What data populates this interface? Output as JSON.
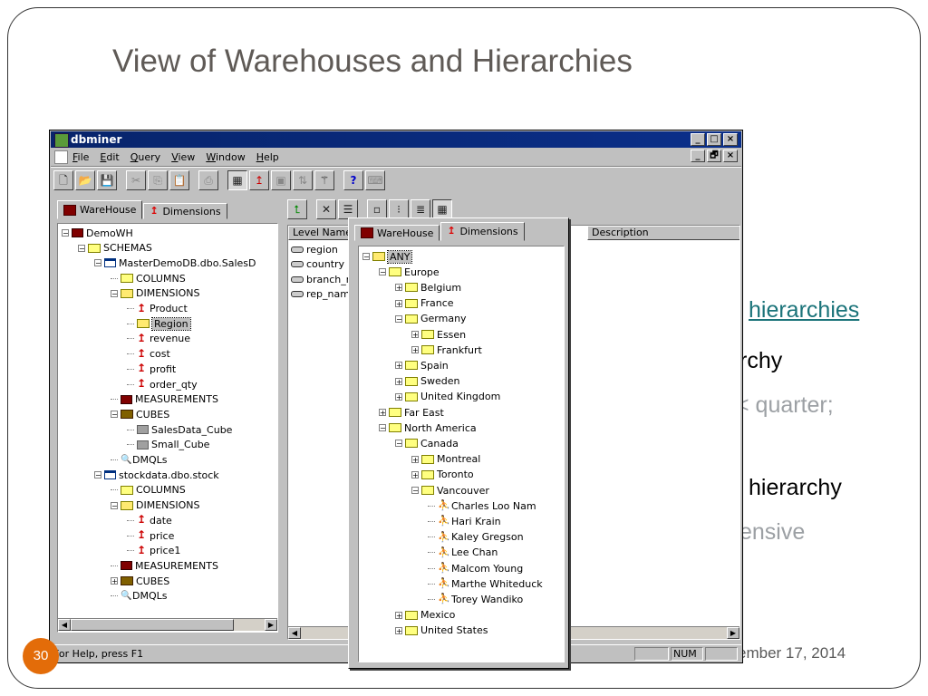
{
  "slide": {
    "title": "View of Warehouses and Hierarchies",
    "bullets": [
      " hierarchies",
      "rchy",
      "< quarter;",
      "–",
      " hierarchy",
      "ensive"
    ],
    "date": "ember 17, 2014",
    "page_number": "30"
  },
  "window": {
    "title": "dbminer",
    "menu": [
      "File",
      "Edit",
      "Query",
      "View",
      "Window",
      "Help"
    ],
    "controls": {
      "minimize": "_",
      "maximize": "□",
      "close": "×",
      "restore": "🗗"
    },
    "toolbar_icons": [
      "new-icon",
      "open-icon",
      "save-icon",
      "cut-icon",
      "copy-icon",
      "paste-icon",
      "print-icon",
      "warehouse-view-icon",
      "dimension-view-icon",
      "cube-icon",
      "sort-icon",
      "magic-wand-icon",
      "help-icon",
      "keyboard-icon"
    ],
    "left_tabs": [
      "WareHouse",
      "Dimensions"
    ],
    "left_tree": [
      {
        "label": "DemoWH",
        "icon": "warehouse",
        "pm": "−"
      },
      {
        "label": "SCHEMAS",
        "icon": "folder",
        "pm": "−"
      },
      {
        "label": "MasterDemoDB.dbo.SalesD",
        "icon": "table",
        "pm": "−"
      },
      {
        "label": "COLUMNS",
        "icon": "folder"
      },
      {
        "label": "DIMENSIONS",
        "icon": "folder-open",
        "pm": "−"
      },
      {
        "label": "Product",
        "icon": "dim"
      },
      {
        "label": "Region",
        "icon": "folder-open"
      },
      {
        "label": "revenue",
        "icon": "dim"
      },
      {
        "label": "cost",
        "icon": "dim"
      },
      {
        "label": "profit",
        "icon": "dim"
      },
      {
        "label": "order_qty",
        "icon": "dim"
      },
      {
        "label": "MEASUREMENTS",
        "icon": "meas"
      },
      {
        "label": "CUBES",
        "icon": "cubes",
        "pm": "−"
      },
      {
        "label": "SalesData_Cube",
        "icon": "cube"
      },
      {
        "label": "Small_Cube",
        "icon": "cube"
      },
      {
        "label": "DMQLs",
        "icon": "dmql"
      },
      {
        "label": "stockdata.dbo.stock",
        "icon": "table",
        "pm": "−"
      },
      {
        "label": "COLUMNS",
        "icon": "folder"
      },
      {
        "label": "DIMENSIONS",
        "icon": "folder-open",
        "pm": "−"
      },
      {
        "label": "date",
        "icon": "dim"
      },
      {
        "label": "price",
        "icon": "dim"
      },
      {
        "label": "price1",
        "icon": "dim"
      },
      {
        "label": "MEASUREMENTS",
        "icon": "meas"
      },
      {
        "label": "CUBES",
        "icon": "cubes",
        "pm": "+"
      },
      {
        "label": "DMQLs",
        "icon": "dmql"
      }
    ],
    "grid": {
      "columns": [
        "Level Name",
        "Description"
      ],
      "rows": [
        "region",
        "country",
        "branch_r",
        "rep_nam"
      ]
    },
    "status": {
      "help_text": "For Help, press F1",
      "num": "NUM"
    }
  },
  "popup": {
    "tabs": [
      "WareHouse",
      "Dimensions"
    ],
    "tree": [
      {
        "label": "ANY",
        "icon": "folder-open",
        "pm": "−"
      },
      {
        "label": "Europe",
        "icon": "folder",
        "pm": "−"
      },
      {
        "label": "Belgium",
        "icon": "folder",
        "pm": "+"
      },
      {
        "label": "France",
        "icon": "folder",
        "pm": "+"
      },
      {
        "label": "Germany",
        "icon": "folder",
        "pm": "−"
      },
      {
        "label": "Essen",
        "icon": "folder",
        "pm": "+"
      },
      {
        "label": "Frankfurt",
        "icon": "folder",
        "pm": "+"
      },
      {
        "label": "Spain",
        "icon": "folder",
        "pm": "+"
      },
      {
        "label": "Sweden",
        "icon": "folder",
        "pm": "+"
      },
      {
        "label": "United Kingdom",
        "icon": "folder",
        "pm": "+"
      },
      {
        "label": "Far East",
        "icon": "folder",
        "pm": "+"
      },
      {
        "label": "North America",
        "icon": "folder",
        "pm": "−"
      },
      {
        "label": "Canada",
        "icon": "folder",
        "pm": "−"
      },
      {
        "label": "Montreal",
        "icon": "folder",
        "pm": "+"
      },
      {
        "label": "Toronto",
        "icon": "folder",
        "pm": "+"
      },
      {
        "label": "Vancouver",
        "icon": "folder",
        "pm": "−"
      },
      {
        "label": "Charles Loo Nam",
        "icon": "person"
      },
      {
        "label": "Hari Krain",
        "icon": "person"
      },
      {
        "label": "Kaley Gregson",
        "icon": "person"
      },
      {
        "label": "Lee Chan",
        "icon": "person"
      },
      {
        "label": "Malcom Young",
        "icon": "person"
      },
      {
        "label": "Marthe Whiteduck",
        "icon": "person"
      },
      {
        "label": "Torey Wandiko",
        "icon": "person"
      },
      {
        "label": "Mexico",
        "icon": "folder",
        "pm": "+"
      },
      {
        "label": "United States",
        "icon": "folder",
        "pm": "+"
      }
    ]
  },
  "colors": {
    "accent": "#e36c09",
    "titlebar": "#08246b",
    "link": "#1a7379"
  }
}
